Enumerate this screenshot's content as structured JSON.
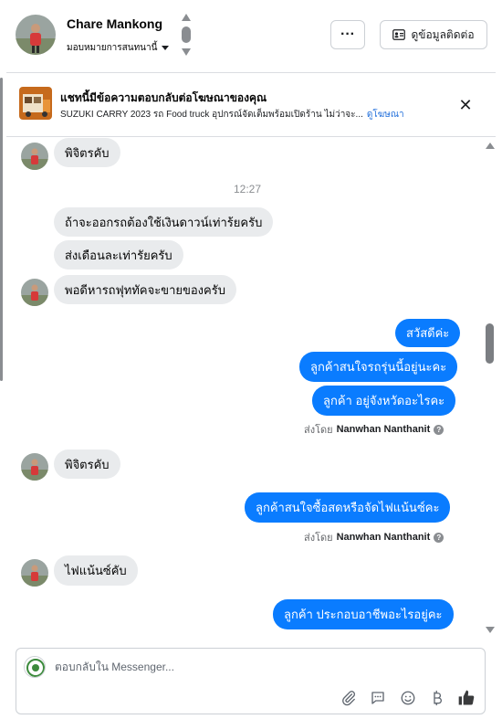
{
  "header": {
    "contact_name": "Chare Mankong",
    "assign_label": "มอบหมายการสนทนานี้",
    "more_label": "···",
    "contact_info_label": "ดูข้อมูลติดต่อ"
  },
  "ad": {
    "title": "แชทนี้มีข้อความตอบกลับต่อโฆษณาของคุณ",
    "description": "SUZUKI CARRY 2023 รถ Food truck อุปกรณ์จัดเต็มพร้อมเปิดร้าน ไม่ว่าจะ...",
    "link": "ดูโฆษณา",
    "close": "✕"
  },
  "messages": {
    "m1": "พิจิตรคับ",
    "time1": "12:27",
    "m2": "ถ้าจะออกรถต้องใช้เงินดาวน์เท่าร้ยครับ",
    "m3": "ส่งเดือนละเท่ารัยครับ",
    "m4": "พอดีหารถฟุททัคจะขายของครับ",
    "m5": "สวัสดีค่ะ",
    "m6": "ลูกค้าสนใจรถรุ่นนี้อยู่นะคะ",
    "m7": "ลูกค้า อยู่จังหวัดอะไรคะ",
    "sent_by_prefix": "ส่งโดย",
    "agent_name": "Nanwhan Nanthanit",
    "m8": "พิจิตรคับ",
    "m9": "ลูกค้าสนใจซื้อสดหรือจัดไฟแน้นซ์คะ",
    "m10": "ไฟแน้นซ์คับ",
    "m11": "ลูกค้า ประกอบอาชีพอะไรอยู่คะ"
  },
  "composer": {
    "placeholder": "ตอบกลับใน Messenger..."
  },
  "colors": {
    "outgoing": "#0a7cff",
    "incoming": "#e9ebed",
    "link": "#216fdb"
  }
}
